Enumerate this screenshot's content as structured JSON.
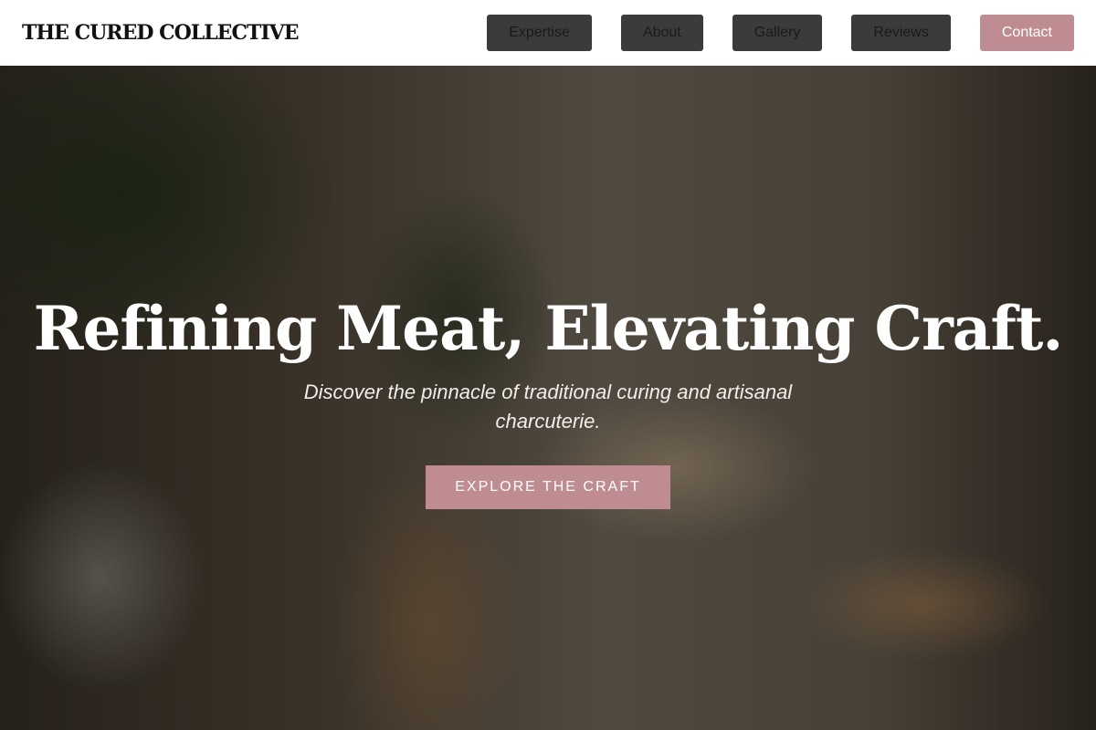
{
  "header": {
    "brand": "THE CURED COLLECTIVE",
    "nav": [
      {
        "label": "Expertise"
      },
      {
        "label": "About"
      },
      {
        "label": "Gallery"
      },
      {
        "label": "Reviews"
      },
      {
        "label": "Contact"
      }
    ]
  },
  "hero": {
    "title": "Refining Meat, Elevating Craft.",
    "subtitle": "Discover the pinnacle of traditional curing and artisanal charcuterie.",
    "cta_label": "EXPLORE THE CRAFT"
  },
  "colors": {
    "accent": "#bf8d91",
    "nav_button": "#3b3b3b",
    "header_bg": "#ffffff"
  }
}
